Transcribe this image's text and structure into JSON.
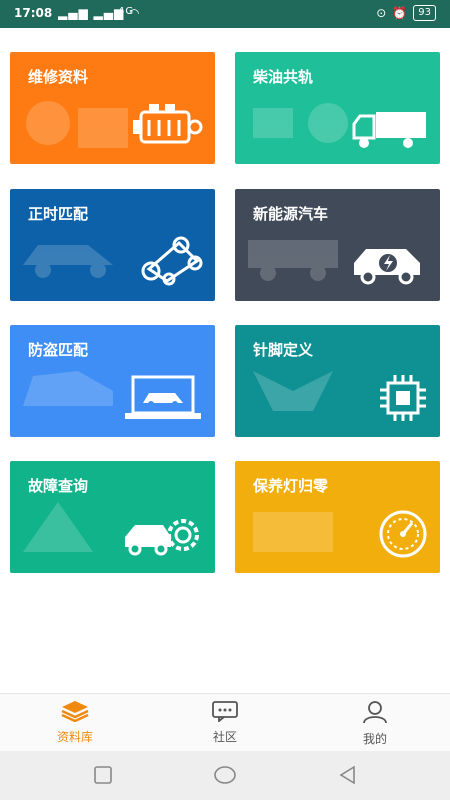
{
  "status_bar": {
    "time": "17:08",
    "network": "4G",
    "battery": "93",
    "bg_color": "#1f6a5a"
  },
  "tiles": [
    {
      "label": "维修资料",
      "color": "#fe7b13",
      "icon": "engine-icon"
    },
    {
      "label": "柴油共轨",
      "color": "#1fbf99",
      "icon": "truck-icon"
    },
    {
      "label": "正时匹配",
      "color": "#0d61a8",
      "icon": "timing-belt-icon"
    },
    {
      "label": "新能源汽车",
      "color": "#414a59",
      "icon": "electric-car-icon"
    },
    {
      "label": "防盗匹配",
      "color": "#3f8ef5",
      "icon": "laptop-car-icon"
    },
    {
      "label": "针脚定义",
      "color": "#0f9194",
      "icon": "chip-icon"
    },
    {
      "label": "故障查询",
      "color": "#10b38a",
      "icon": "car-search-icon"
    },
    {
      "label": "保养灯归零",
      "color": "#f2ae0c",
      "icon": "speedometer-icon"
    }
  ],
  "bottom_nav": {
    "items": [
      {
        "label": "资料库",
        "icon": "layers-icon",
        "active": true
      },
      {
        "label": "社区",
        "icon": "chat-icon",
        "active": false
      },
      {
        "label": "我的",
        "icon": "person-icon",
        "active": false
      }
    ],
    "active_color": "#f08a0f",
    "inactive_color": "#555555"
  }
}
